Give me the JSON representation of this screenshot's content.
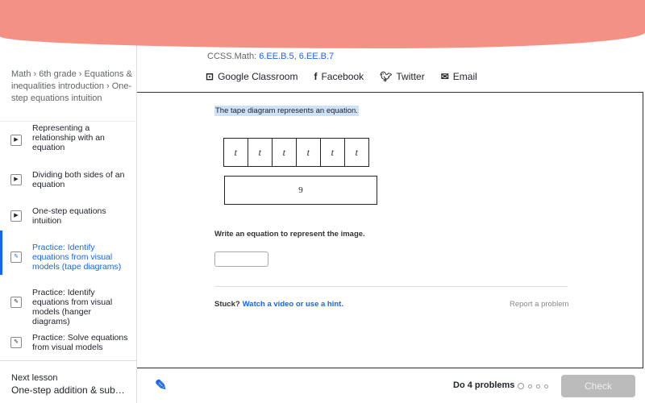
{
  "header": {
    "ccss_prefix": "CCSS.Math: ",
    "ccss_links": [
      "6.EE.B.5",
      "6.EE.B.7"
    ]
  },
  "share": {
    "google": "Google Classroom",
    "facebook": "Facebook",
    "twitter": "Twitter",
    "email": "Email"
  },
  "sidebar": {
    "breadcrumb": [
      "Math",
      "6th grade",
      "Equations & inequalities introduction",
      "One-step equations intuition"
    ],
    "items": [
      {
        "label": "Representing a relationship with an equation",
        "icon": "play-icon"
      },
      {
        "label": "Dividing both sides of an equation",
        "icon": "play-icon"
      },
      {
        "label": "One-step equations intuition",
        "icon": "play-icon"
      },
      {
        "label": "Practice: Identify equations from visual models (tape diagrams)",
        "icon": "pencil-icon",
        "active": true
      },
      {
        "label": "Practice: Identify equations from visual models (hanger diagrams)",
        "icon": "pencil-icon"
      },
      {
        "label": "Practice: Solve equations from visual models",
        "icon": "pencil-icon"
      }
    ],
    "next_label": "Next lesson",
    "next_title": "One-step addition & subtraction equations"
  },
  "problem": {
    "question": "The tape diagram represents an equation.",
    "cells": [
      "t",
      "t",
      "t",
      "t",
      "t",
      "t"
    ],
    "total": "9",
    "prompt": "Write an equation to represent the image.",
    "answer": "",
    "stuck": "Stuck?",
    "hint_link": "Watch a video or use a hint.",
    "report": "Report a problem"
  },
  "footer": {
    "do_label": "Do 4 problems",
    "progress_completed": 0,
    "progress_total": 4,
    "check": "Check"
  },
  "colors": {
    "accent": "#1865f2",
    "redaction": "#f28b7e"
  }
}
